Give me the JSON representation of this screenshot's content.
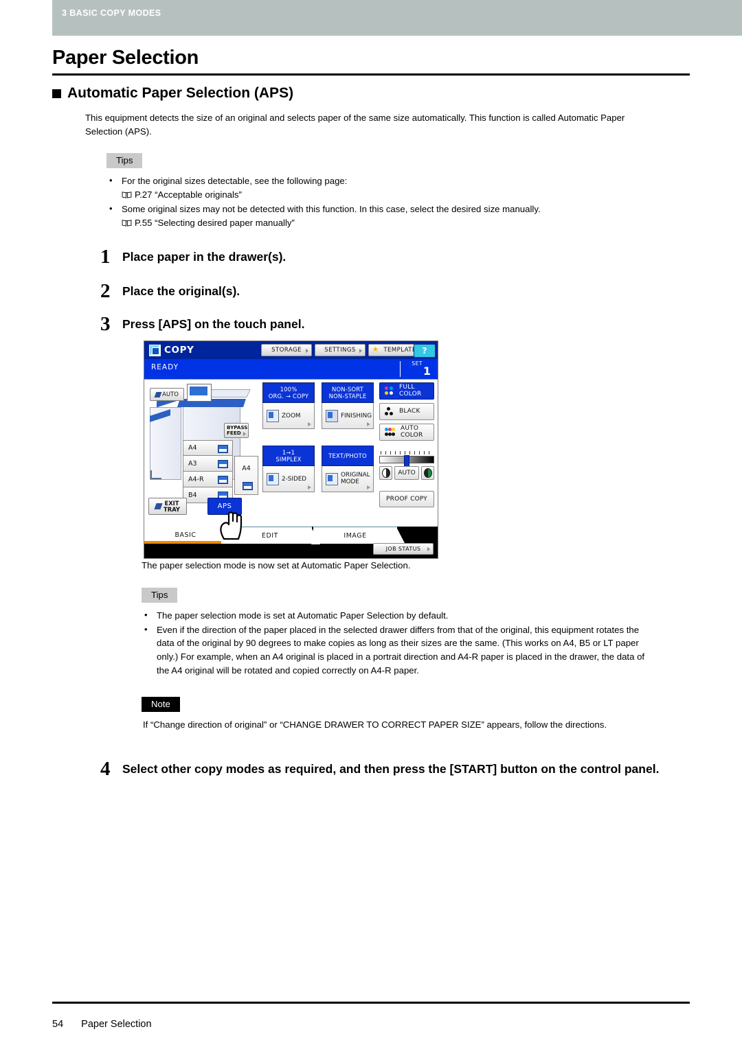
{
  "running_header": {
    "text": "3 BASIC COPY MODES"
  },
  "page": {
    "title": "Paper Selection",
    "section_heading": "Automatic Paper Selection (APS)",
    "intro": "This equipment detects the size of an original and selects paper of the same size automatically. This function is called Automatic Paper Selection (APS)."
  },
  "tips_1": {
    "label": "Tips",
    "items": [
      {
        "text": "For the original sizes detectable, see the following page:",
        "ref": "P.27 “Acceptable originals”"
      },
      {
        "text": "Some original sizes may not be detected with this function. In this case, select the desired size manually.",
        "ref": "P.55 “Selecting desired paper manually”"
      }
    ]
  },
  "steps": [
    {
      "num": "1",
      "text": "Place paper in the drawer(s)."
    },
    {
      "num": "2",
      "text": "Place the original(s)."
    },
    {
      "num": "3",
      "text": "Press [APS] on the touch panel."
    },
    {
      "num": "4",
      "text": "Select other copy modes as required, and then press the [START] button on the control panel."
    }
  ],
  "after_panel_text": "The paper selection mode is now set at Automatic Paper Selection.",
  "tips_2": {
    "label": "Tips",
    "items": [
      {
        "text": "The paper selection mode is set at Automatic Paper Selection by default."
      },
      {
        "text": "Even if the direction of the paper placed in the selected drawer differs from that of the original, this equipment rotates the data of the original by 90 degrees to make copies as long as their sizes are the same. (This works on A4, B5 or LT paper only.) For example, when an A4 original is placed in a portrait direction and A4-R paper is placed in the drawer, the data of the A4 original will be rotated and copied correctly on A4-R paper."
      }
    ]
  },
  "note": {
    "label": "Note",
    "text": "If “Change direction of original” or “CHANGE DRAWER TO CORRECT PAPER SIZE” appears, follow the directions."
  },
  "footer": {
    "page_number": "54",
    "section": "Paper Selection"
  },
  "touch_panel": {
    "app_title": "COPY",
    "header_buttons": [
      {
        "label": "STORAGE"
      },
      {
        "label": "SETTINGS"
      },
      {
        "label": "TEMPLATE"
      }
    ],
    "help_label": "?",
    "status": "READY",
    "set_label": "SET",
    "set_value": "1",
    "auto_tag": "AUTO",
    "bypass_feed": "BYPASS FEED",
    "drawers": [
      {
        "size": "A4"
      },
      {
        "size": "A3"
      },
      {
        "size": "A4-R"
      },
      {
        "size": "B4"
      }
    ],
    "selected_paper": "A4",
    "exit_tray": "EXIT TRAY",
    "aps_button": "APS",
    "combos": [
      {
        "title": "100%\nORG. → COPY",
        "title_line1": "100%",
        "title_line2": "ORG. → COPY",
        "label": "ZOOM"
      },
      {
        "title_line1": "NON-SORT",
        "title_line2": "NON-STAPLE",
        "label": "FINISHING"
      },
      {
        "title_line1": "1→1",
        "title_line2": "SIMPLEX",
        "label": "2-SIDED"
      },
      {
        "title_line1": "TEXT/PHOTO",
        "title_line2": "",
        "label": "ORIGINAL MODE"
      }
    ],
    "color_modes": [
      {
        "label": "FULL COLOR",
        "selected": true
      },
      {
        "label": "BLACK",
        "selected": false
      },
      {
        "label": "AUTO COLOR",
        "selected": false
      }
    ],
    "density": {
      "auto_label": "AUTO"
    },
    "proof_copy": "PROOF COPY",
    "tabs": [
      {
        "label": "BASIC",
        "active": true
      },
      {
        "label": "EDIT",
        "active": false
      },
      {
        "label": "IMAGE",
        "active": false
      }
    ],
    "job_status": "JOB STATUS",
    "colors": {
      "header_blue": "#00249c",
      "status_blue": "#0032e6",
      "selected_blue": "#0b34d6",
      "active_tab_orange": "#f08a00",
      "help_cyan": "#32c8e6"
    }
  },
  "theme": {
    "header_bar": "#b6c1bf",
    "tips_bg": "#c9c9c9",
    "note_bg": "#000000"
  }
}
